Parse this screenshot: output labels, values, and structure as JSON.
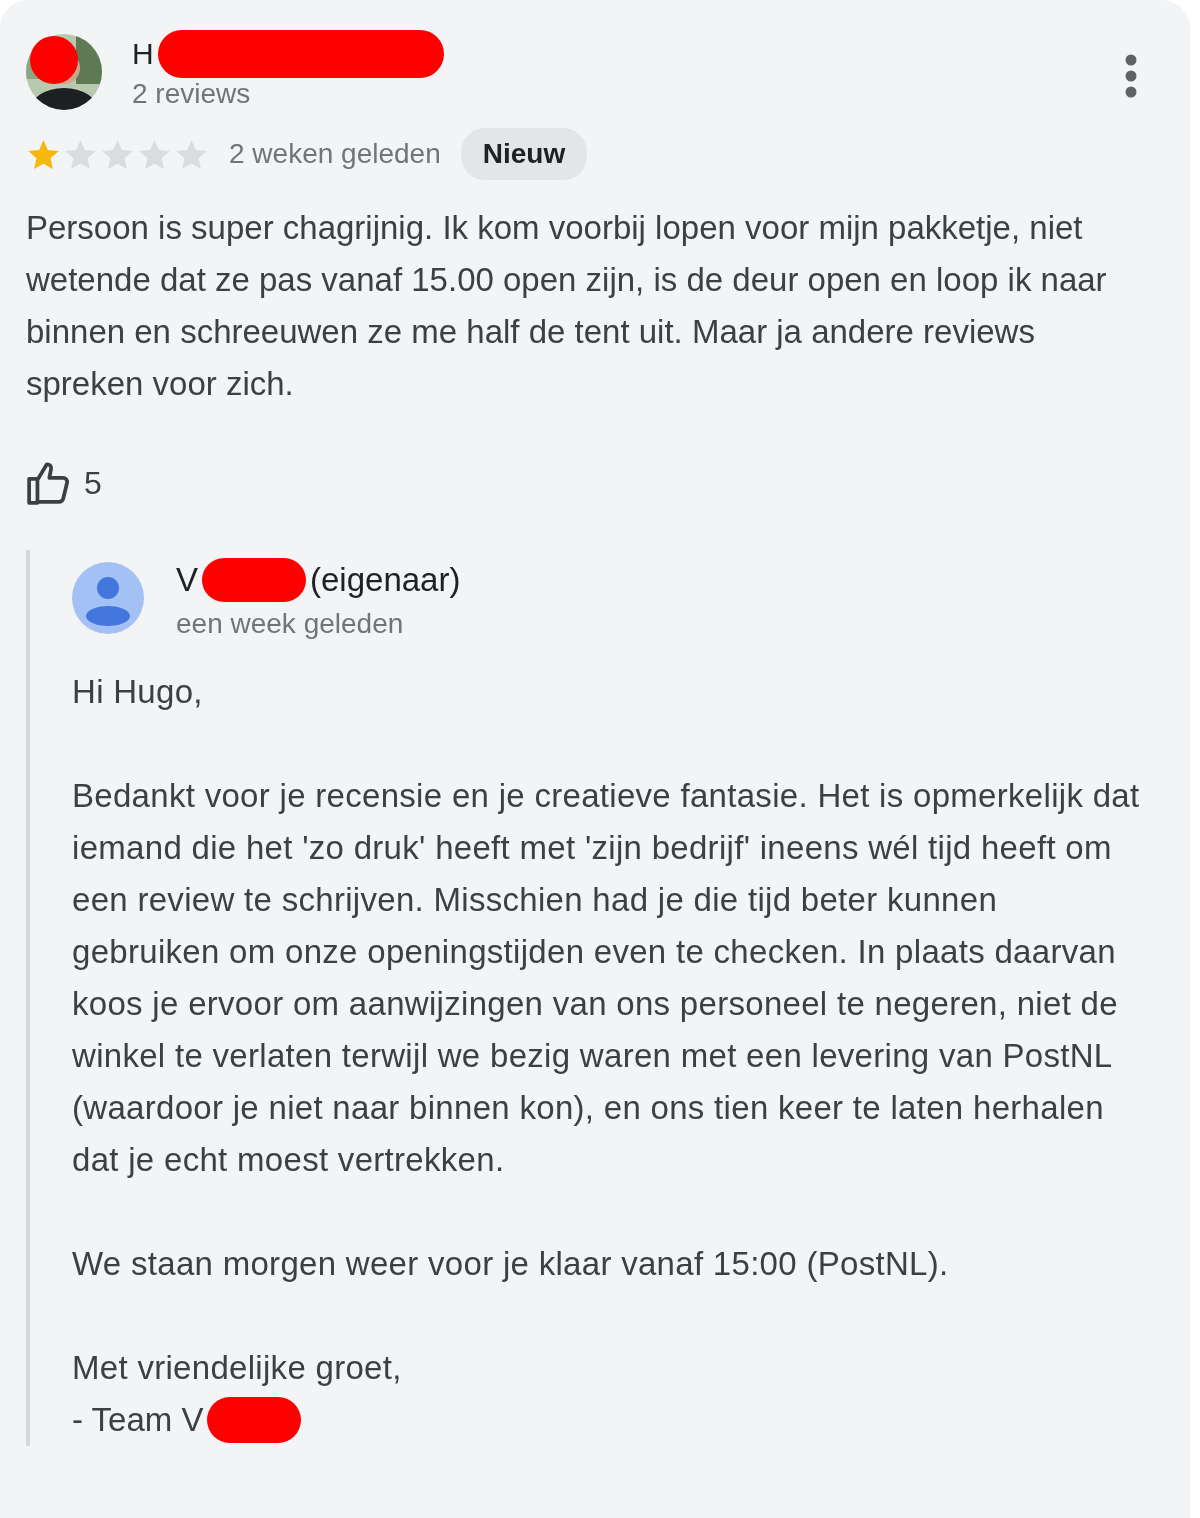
{
  "review": {
    "author": {
      "name": "H",
      "name_redacted": true,
      "avatar_redacted": true,
      "reviews": "2 reviews"
    },
    "stars": 1,
    "time": "2 weken geleden",
    "badge": "Nieuw",
    "text": "Persoon is super chagrijnig. Ik kom voorbij lopen voor mijn pakketje, niet wetende dat ze pas vanaf 15.00 open zijn, is de deur open en loop ik naar binnen en schreeuwen ze me half de tent uit. Maar ja andere reviews spreken voor zich.",
    "likes": "5"
  },
  "reply": {
    "author": "V",
    "author_redacted": true,
    "role": "(eigenaar)",
    "time": "een week geleden",
    "paragraphs": [
      "Hi Hugo,",
      "Bedankt voor je recensie en je creatieve fantasie. Het is opmerkelijk dat iemand die het 'zo druk' heeft met 'zijn bedrijf' ineens wél tijd heeft om een review te schrijven. Misschien had je die tijd beter kunnen gebruiken om onze openingstijden even te checken. In plaats daarvan koos je ervoor om aanwijzingen van ons personeel te negeren, niet de winkel te verlaten terwijl we bezig waren met een levering van PostNL (waardoor je niet naar binnen kon), en ons tien keer te laten herhalen dat je echt moest vertrekken.",
      "We staan morgen weer voor je klaar vanaf 15:00 (PostNL).",
      "Met vriendelijke groet,"
    ],
    "signature": {
      "text": "- Team V",
      "redacted": true
    }
  }
}
